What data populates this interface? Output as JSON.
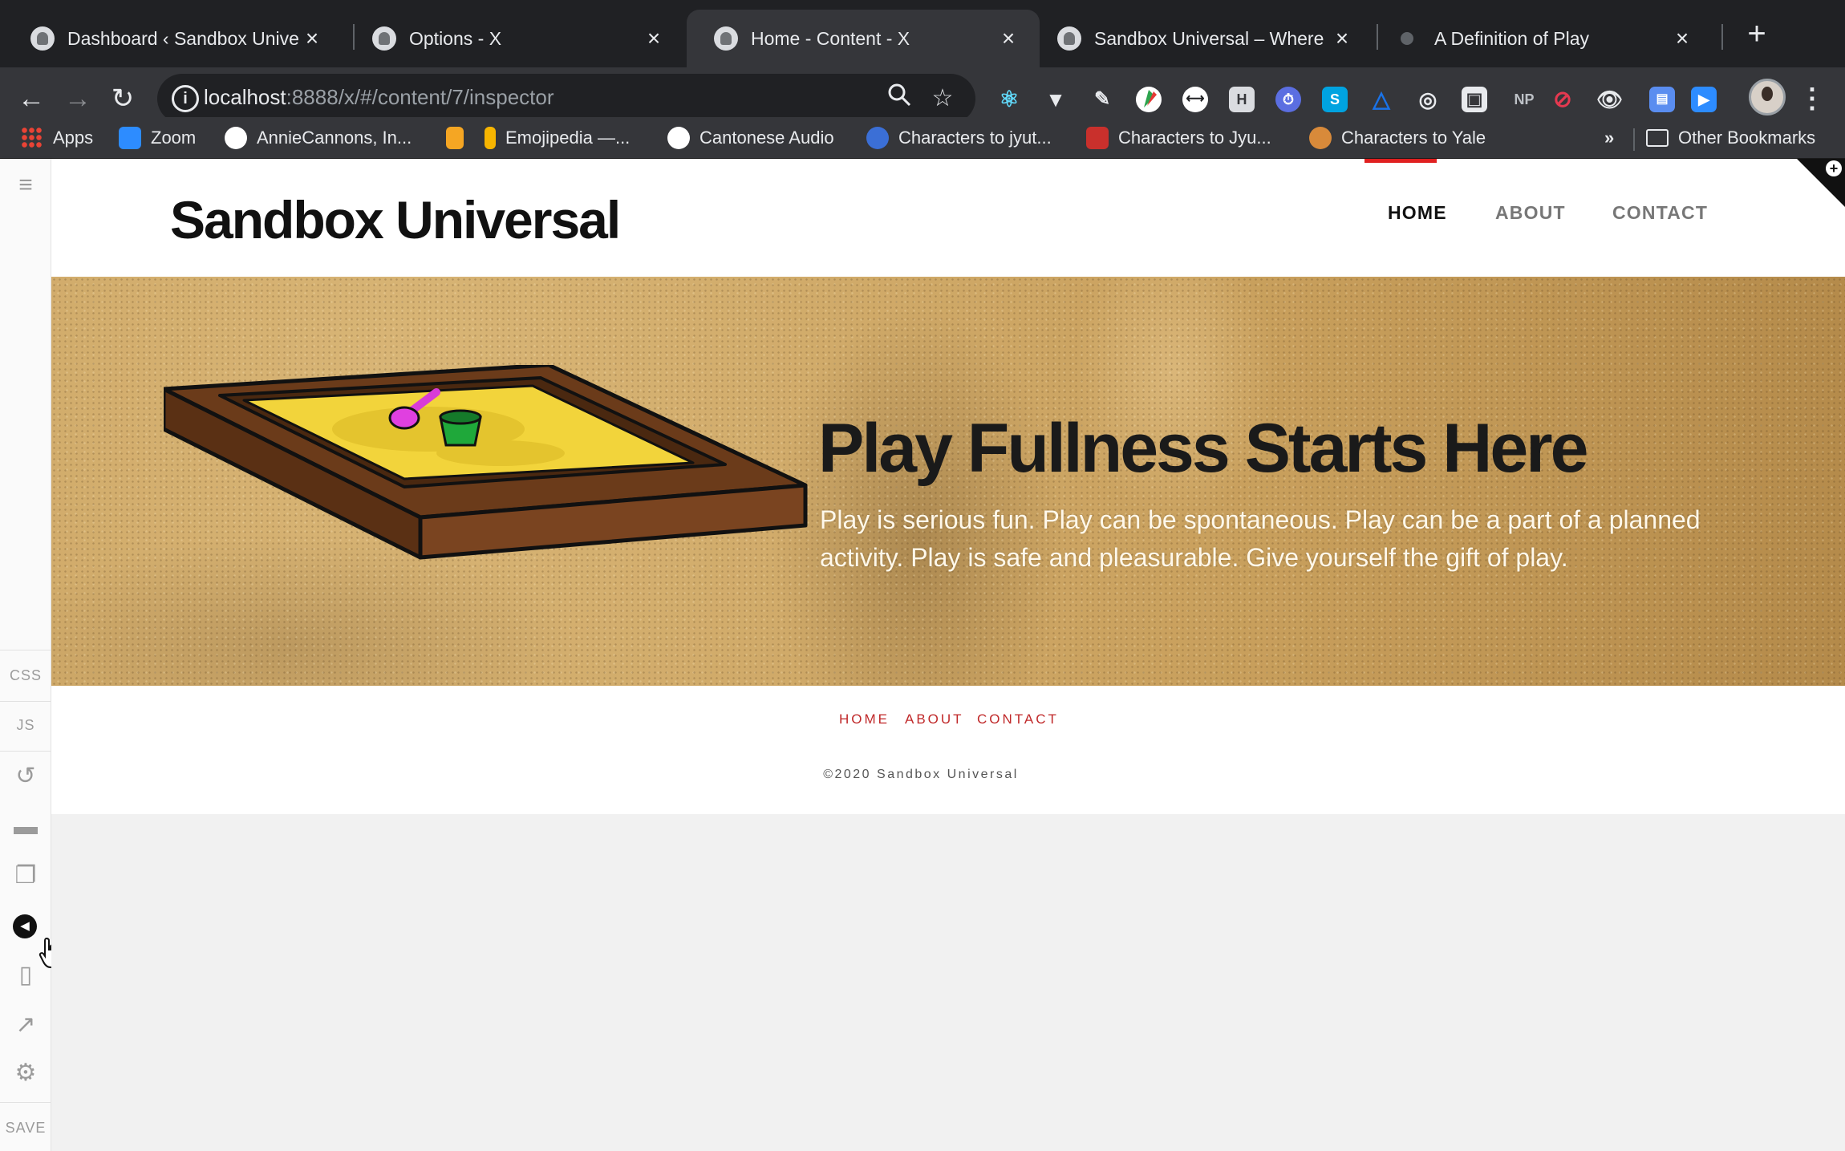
{
  "browser": {
    "tabs": [
      {
        "title": "Dashboard ‹ Sandbox Univers…",
        "active": false
      },
      {
        "title": "Options - X",
        "active": false
      },
      {
        "title": "Home - Content - X",
        "active": true
      },
      {
        "title": "Sandbox Universal – Where Li…",
        "active": false
      },
      {
        "title": "A Definition of Play",
        "active": false
      }
    ],
    "new_tab_icon": "plus-icon",
    "url_host": "localhost",
    "url_path": ":8888/x/#/content/7/inspector",
    "bookmarks": [
      {
        "label": "Apps",
        "color": "#4285f4"
      },
      {
        "label": "Zoom",
        "color": "#2d8cff"
      },
      {
        "label": "AnnieCannons, In...",
        "color": "#ffffff"
      },
      {
        "label": "",
        "color": "#f5a623"
      },
      {
        "label": "Emojipedia —...",
        "color": "#f7b500"
      },
      {
        "label": "Cantonese Audio",
        "color": "#ffffff"
      },
      {
        "label": "Characters to jyut...",
        "color": "#3b6fd6"
      },
      {
        "label": "Characters to Jyu...",
        "color": "#c9302c"
      },
      {
        "label": "Characters to Yale",
        "color": "#d88a3a"
      }
    ],
    "bookmarks_overflow": "»",
    "other_bookmarks": "Other Bookmarks",
    "extension_text": {
      "h": "H",
      "s": "S",
      "np": "NP"
    }
  },
  "editor_rail": {
    "css_label": "CSS",
    "js_label": "JS",
    "save_label": "SAVE"
  },
  "site": {
    "brand": "Sandbox Universal",
    "nav": [
      "HOME",
      "ABOUT",
      "CONTACT"
    ],
    "active_nav": "HOME",
    "accent_color": "#e02020",
    "hero": {
      "title": "Play Fullness Starts Here",
      "text": "Play is serious fun. Play can be spontaneous. Play can be a part of a planned activity. Play is safe and pleasurable. Give yourself the gift of play."
    },
    "footer": {
      "nav": [
        "HOME",
        "ABOUT",
        "CONTACT"
      ],
      "copyright": "©2020 Sandbox Universal"
    }
  }
}
